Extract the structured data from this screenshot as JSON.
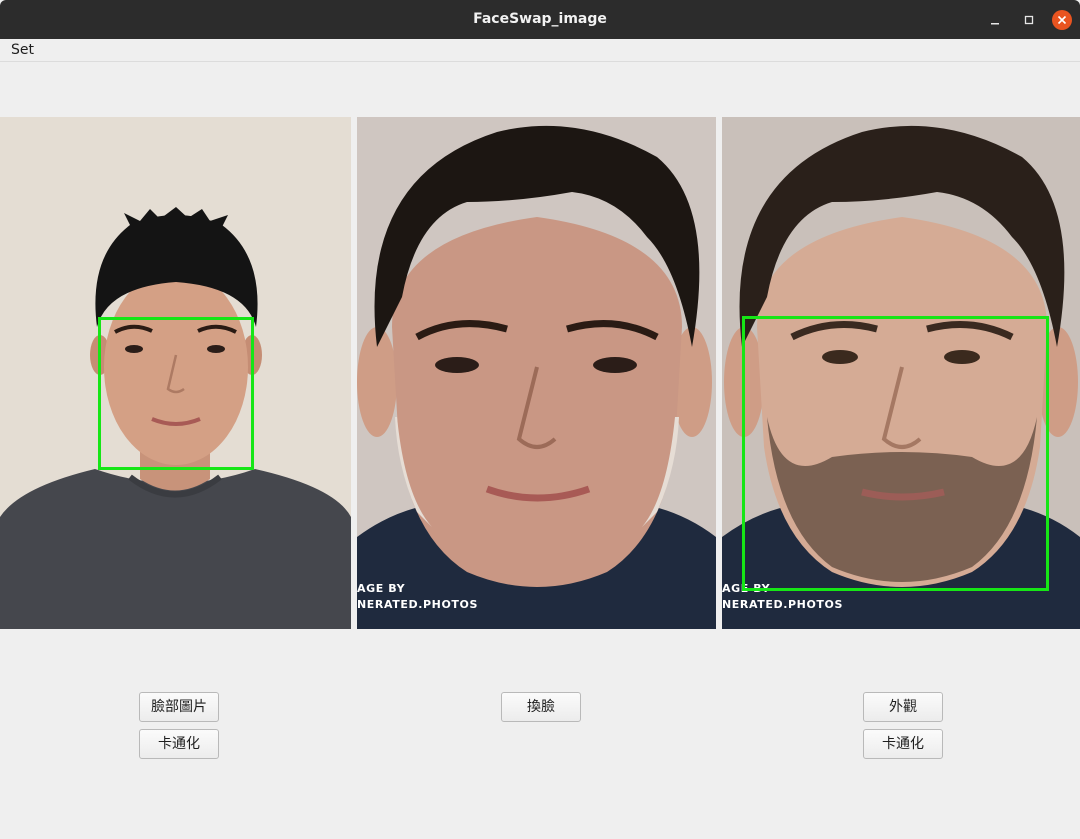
{
  "window": {
    "title": "FaceSwap_image",
    "controls": [
      "minimize-icon",
      "maximize-icon",
      "close-icon"
    ],
    "close_color": "#e95420"
  },
  "menu": {
    "items": [
      {
        "label": "Set"
      }
    ]
  },
  "panels": {
    "source": {
      "image": "person-photo",
      "face_box_color": "#16e616"
    },
    "result": {
      "image": "face-swapped-photo",
      "watermark": [
        "AGE BY",
        "NERATED.PHOTOS"
      ]
    },
    "target": {
      "image": "person-photo",
      "watermark": [
        "AGE BY",
        "NERATED.PHOTOS"
      ],
      "face_box_color": "#16e616"
    }
  },
  "buttons": {
    "left": {
      "face_image": "臉部圖片",
      "cartoon": "卡通化"
    },
    "center": {
      "swap": "換臉"
    },
    "right": {
      "appearance": "外觀",
      "cartoon": "卡通化"
    }
  }
}
